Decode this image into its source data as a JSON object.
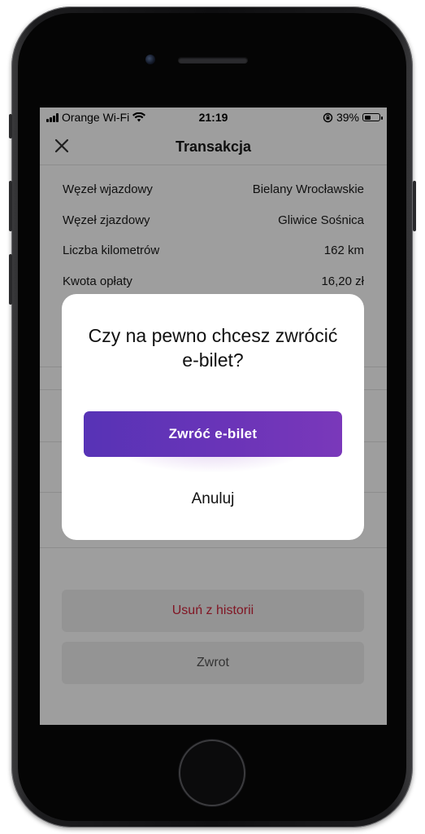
{
  "status_bar": {
    "carrier": "Orange Wi-Fi",
    "time": "21:19",
    "battery": "39%",
    "battery_level": 0.39
  },
  "nav": {
    "title": "Transakcja",
    "close_icon": "close-icon"
  },
  "details": [
    {
      "label": "Węzeł wjazdowy",
      "value": "Bielany Wrocławskie"
    },
    {
      "label": "Węzeł zjazdowy",
      "value": "Gliwice Sośnica"
    },
    {
      "label": "Liczba kilometrów",
      "value": "162 km"
    },
    {
      "label": "Kwota opłaty",
      "value": "16,20 zł"
    }
  ],
  "actions": {
    "delete_label": "Usuń z historii",
    "refund_label": "Zwrot"
  },
  "dialog": {
    "title": "Czy na pewno chcesz zwrócić e-bilet?",
    "confirm_label": "Zwróć e-bilet",
    "cancel_label": "Anuluj"
  },
  "colors": {
    "primary_start": "#5733b6",
    "primary_end": "#7a38ba",
    "danger": "#d0243a"
  }
}
